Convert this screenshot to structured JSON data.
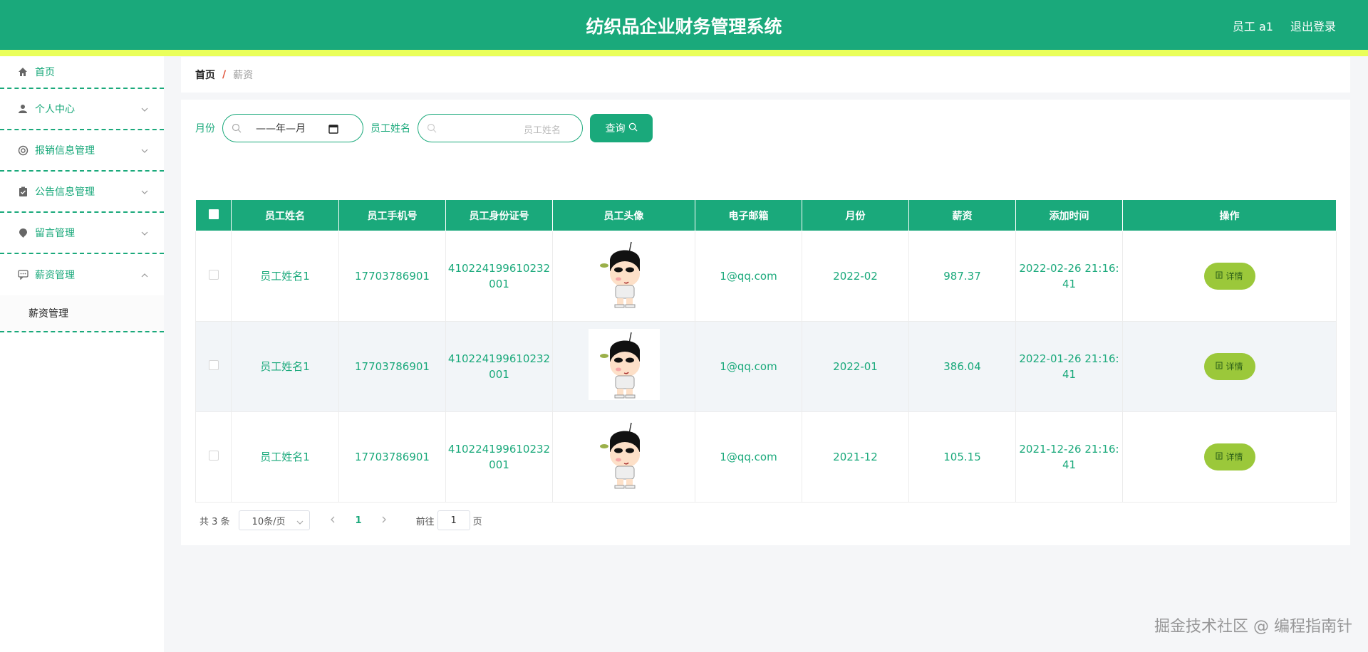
{
  "header": {
    "title": "纺织品企业财务管理系统",
    "user": "员工 a1",
    "logout": "退出登录"
  },
  "sidebar": {
    "items": [
      {
        "label": "首页",
        "icon": "home-icon"
      },
      {
        "label": "个人中心",
        "icon": "user-icon"
      },
      {
        "label": "报销信息管理",
        "icon": "lifebuoy-icon"
      },
      {
        "label": "公告信息管理",
        "icon": "clipboard-icon"
      },
      {
        "label": "留言管理",
        "icon": "pin-icon"
      },
      {
        "label": "薪资管理",
        "icon": "chat-icon"
      }
    ],
    "submenu": {
      "label": "薪资管理"
    }
  },
  "breadcrumb": {
    "home": "首页",
    "separator": "/",
    "current": "薪资"
  },
  "search": {
    "month_label": "月份",
    "month_value": "——年—月",
    "name_label": "员工姓名",
    "name_placeholder": "员工姓名",
    "query_button": "查询"
  },
  "table": {
    "headers": [
      "员工姓名",
      "员工手机号",
      "员工身份证号",
      "员工头像",
      "电子邮箱",
      "月份",
      "薪资",
      "添加时间",
      "操作"
    ],
    "rows": [
      {
        "name": "员工姓名1",
        "phone": "17703786901",
        "id1": "410224199610232",
        "id2": "001",
        "email": "1@qq.com",
        "month": "2022-02",
        "salary": "987.37",
        "time1": "2022-02-26 21:16:",
        "time2": "41",
        "action": "详情"
      },
      {
        "name": "员工姓名1",
        "phone": "17703786901",
        "id1": "410224199610232",
        "id2": "001",
        "email": "1@qq.com",
        "month": "2022-01",
        "salary": "386.04",
        "time1": "2022-01-26 21:16:",
        "time2": "41",
        "action": "详情"
      },
      {
        "name": "员工姓名1",
        "phone": "17703786901",
        "id1": "410224199610232",
        "id2": "001",
        "email": "1@qq.com",
        "month": "2021-12",
        "salary": "105.15",
        "time1": "2021-12-26 21:16:",
        "time2": "41",
        "action": "详情"
      }
    ]
  },
  "pagination": {
    "total": "共 3 条",
    "page_size": "10条/页",
    "current_page": "1",
    "goto_label": "前往",
    "goto_value": "1",
    "page_suffix": "页"
  },
  "watermark": "掘金技术社区 @ 编程指南针",
  "colors": {
    "primary": "#1aa97b",
    "stripe": "#eaff5a",
    "detail": "#9bc83a"
  }
}
